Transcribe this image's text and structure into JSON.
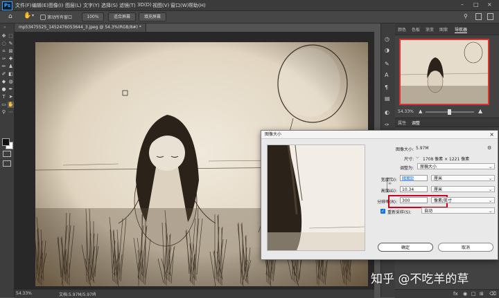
{
  "app": {
    "logo": "Ps"
  },
  "menu": [
    "文件(F)",
    "编辑(E)",
    "图像(I)",
    "图层(L)",
    "文字(Y)",
    "选择(S)",
    "滤镜(T)",
    "3D(D)",
    "视图(V)",
    "窗口(W)",
    "帮助(H)"
  ],
  "options_bar": {
    "scroll_all": "滚动所有窗口",
    "zoom": "100%",
    "fit_screen": "适合屏幕",
    "fill_screen": "填充屏幕"
  },
  "document_tab": {
    "title": "mp53475525_1452476053644_3.jpeg @ 54.3%(RGB/8#) *",
    "close": "×"
  },
  "status": {
    "zoom": "54.33%",
    "doc": "文档:5.97M/5.97M"
  },
  "panel": {
    "tabs": [
      "颜色",
      "色板",
      "渐变",
      "图案",
      "导航器"
    ],
    "active_tab": "导航器",
    "zoom_value": "54.33%",
    "bottom_tabs": [
      "属性",
      "调整"
    ]
  },
  "dialog": {
    "title": "图像大小",
    "image_size_label": "图像大小:",
    "image_size_value": "5.97M",
    "dimensions_label": "尺寸:",
    "dimensions_value": "1708 像素 × 1221 像素",
    "fit_label": "调整为:",
    "fit_value": "原稿大小",
    "width_label": "宽度(D):",
    "width_value": "14.46",
    "width_unit": "厘米",
    "height_label": "高度(G):",
    "height_value": "10.34",
    "height_unit": "厘米",
    "resolution_label": "分辨率(R):",
    "resolution_value": "300",
    "resolution_unit": "像素/英寸",
    "resample_label": "重新采样(S):",
    "resample_value": "自动",
    "ok": "确定",
    "cancel": "取消",
    "highlight_color": "#d0021b",
    "accent_color": "#1473e6"
  },
  "watermark": "知乎 @不吃羊的草"
}
